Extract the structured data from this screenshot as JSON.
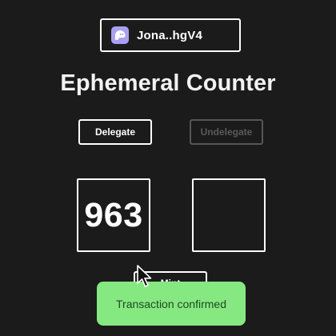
{
  "wallet": {
    "label": "Jona..hgV4",
    "icon": "phantom-ghost-icon",
    "icon_color": "#ab9ff2"
  },
  "title": "Ephemeral Counter",
  "actions": {
    "delegate_label": "Delegate",
    "undelegate_label": "Undelegate",
    "mint_label": "Mint"
  },
  "counters": {
    "left_value": "963",
    "right_value": ""
  },
  "toast": {
    "message": "Transaction confirmed",
    "color": "#86e880"
  },
  "colors": {
    "background": "#1b1b1b",
    "foreground": "#ffffff",
    "disabled": "#555555"
  }
}
